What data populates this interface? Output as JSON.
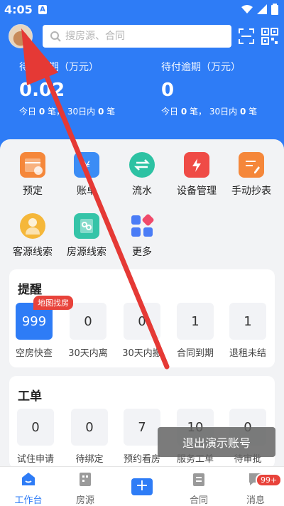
{
  "status_bar": {
    "time": "4:05",
    "notif_letter": "A"
  },
  "search": {
    "placeholder": "搜房源、合同"
  },
  "stats": [
    {
      "title": "待收逾期（万元）",
      "value": "0.02",
      "today_label": "今日",
      "today": "0",
      "unit1": "笔，",
      "month_label": "30日内",
      "month": "0",
      "unit2": "笔"
    },
    {
      "title": "待付逾期（万元）",
      "value": "0",
      "today_label": "今日",
      "today": "0",
      "unit1": "笔，",
      "month_label": "30日内",
      "month": "0",
      "unit2": "笔"
    }
  ],
  "grid": [
    {
      "label": "预定",
      "icon": "calendar-icon",
      "color": "#f5873a"
    },
    {
      "label": "账单",
      "icon": "bill-icon",
      "color": "#3b8cf5"
    },
    {
      "label": "流水",
      "icon": "transfer-icon",
      "color": "#2dc2a3"
    },
    {
      "label": "设备管理",
      "icon": "device-icon",
      "color": "#ef4b46"
    },
    {
      "label": "手动抄表",
      "icon": "edit-doc-icon",
      "color": "#f5873a"
    },
    {
      "label": "客源线索",
      "icon": "customer-icon",
      "color": "#f5b73a"
    },
    {
      "label": "房源线索",
      "icon": "house-key-icon",
      "color": "#35c4a8"
    },
    {
      "label": "更多",
      "icon": "apps-icon",
      "color": "#4a7cf6"
    }
  ],
  "reminder": {
    "title": "提醒",
    "badge": "地图找房",
    "items": [
      {
        "value": "999",
        "label": "空房快查"
      },
      {
        "value": "0",
        "label": "30天内离"
      },
      {
        "value": "0",
        "label": "30天内搬"
      },
      {
        "value": "1",
        "label": "合同到期"
      },
      {
        "value": "1",
        "label": "退租未结"
      }
    ]
  },
  "workorder": {
    "title": "工单",
    "items": [
      {
        "value": "0",
        "label": "试住申请"
      },
      {
        "value": "0",
        "label": "待绑定"
      },
      {
        "value": "7",
        "label": "预约看房"
      },
      {
        "value": "10",
        "label": "服务工单"
      },
      {
        "value": "0",
        "label": "待审批"
      }
    ]
  },
  "toast": "退出演示账号",
  "tabs": [
    {
      "label": "工作台",
      "active": true
    },
    {
      "label": "房源"
    },
    {
      "label": "合同"
    },
    {
      "label": "消息",
      "badge": "99+"
    }
  ],
  "colors": {
    "primary": "#2e7cf6",
    "badge": "#e8433b",
    "arrow": "#e53935"
  }
}
